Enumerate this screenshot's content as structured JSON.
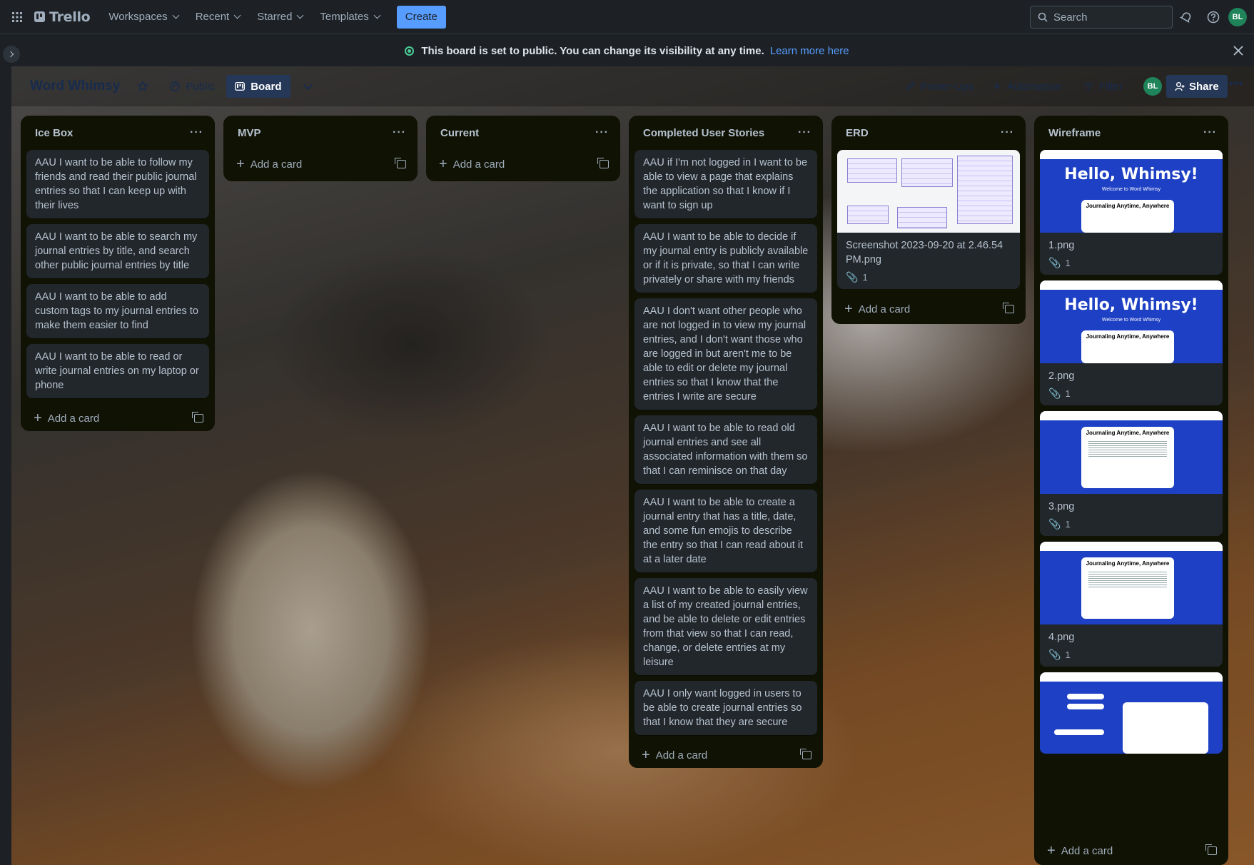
{
  "topbar": {
    "brand": "Trello",
    "nav": [
      "Workspaces",
      "Recent",
      "Starred",
      "Templates"
    ],
    "create_label": "Create",
    "search_placeholder": "Search",
    "avatar_initials": "BL"
  },
  "banner": {
    "text": "This board is set to public. You can change its visibility at any time.",
    "link": "Learn more here"
  },
  "board": {
    "title": "Word Whimsy",
    "visibility": "Public",
    "view": "Board",
    "powerups": "Power-Ups",
    "automation": "Automation",
    "filter": "Filter",
    "share": "Share",
    "member_initials": "BL"
  },
  "add_card_label": "Add a card",
  "lists": [
    {
      "title": "Ice Box",
      "cards": [
        "AAU I want to be able to follow my friends and read their public journal entries so that I can keep up with their lives",
        "AAU I want to be able to search my journal entries by title, and search other public journal entries by title",
        "AAU I want to be able to add custom tags to my journal entries to make them easier to find",
        "AAU I want to be able to read or write journal entries on my laptop or phone"
      ]
    },
    {
      "title": "MVP",
      "cards": []
    },
    {
      "title": "Current",
      "cards": []
    },
    {
      "title": "Completed User Stories",
      "cards": [
        "AAU if I'm not logged in I want to be able to view a page that explains the application so that I know if I want to sign up",
        "AAU I want to be able to decide if my journal entry is publicly available or if it is private, so that I can write privately or share with my friends",
        "AAU I don't want other people who are not logged in to view my journal entries, and I don't want those who are logged in but aren't me to be able to edit or delete my journal entries so that I know that the entries I write are secure",
        "AAU I want to be able to read old journal entries and see all associated information with them so that I can reminisce on that day",
        "AAU I want to be able to create a journal entry that has a title, date, and some fun emojis to describe the entry so that I can read about it at a later date",
        "AAU I want to be able to easily view a list of my created journal entries, and be able to delete or edit entries from that view so that I can read, change, or delete entries at my leisure",
        "AAU I only want logged in users to be able to create journal entries so that I know that they are secure"
      ]
    },
    {
      "title": "ERD",
      "cards": [
        {
          "caption": "Screenshot 2023-09-20 at 2.46.54 PM.png",
          "attachments": "1"
        }
      ]
    },
    {
      "title": "Wireframe",
      "cards": [
        {
          "caption": "1.png",
          "attachments": "1"
        },
        {
          "caption": "2.png",
          "attachments": "1"
        },
        {
          "caption": "3.png",
          "attachments": "1"
        },
        {
          "caption": "4.png",
          "attachments": "1"
        }
      ]
    }
  ],
  "wireframe_text": {
    "hello": "Hello, Whimsy!",
    "welcome": "Welcome to Word Whimsy",
    "journaling": "Journaling Anytime, Anywhere"
  }
}
